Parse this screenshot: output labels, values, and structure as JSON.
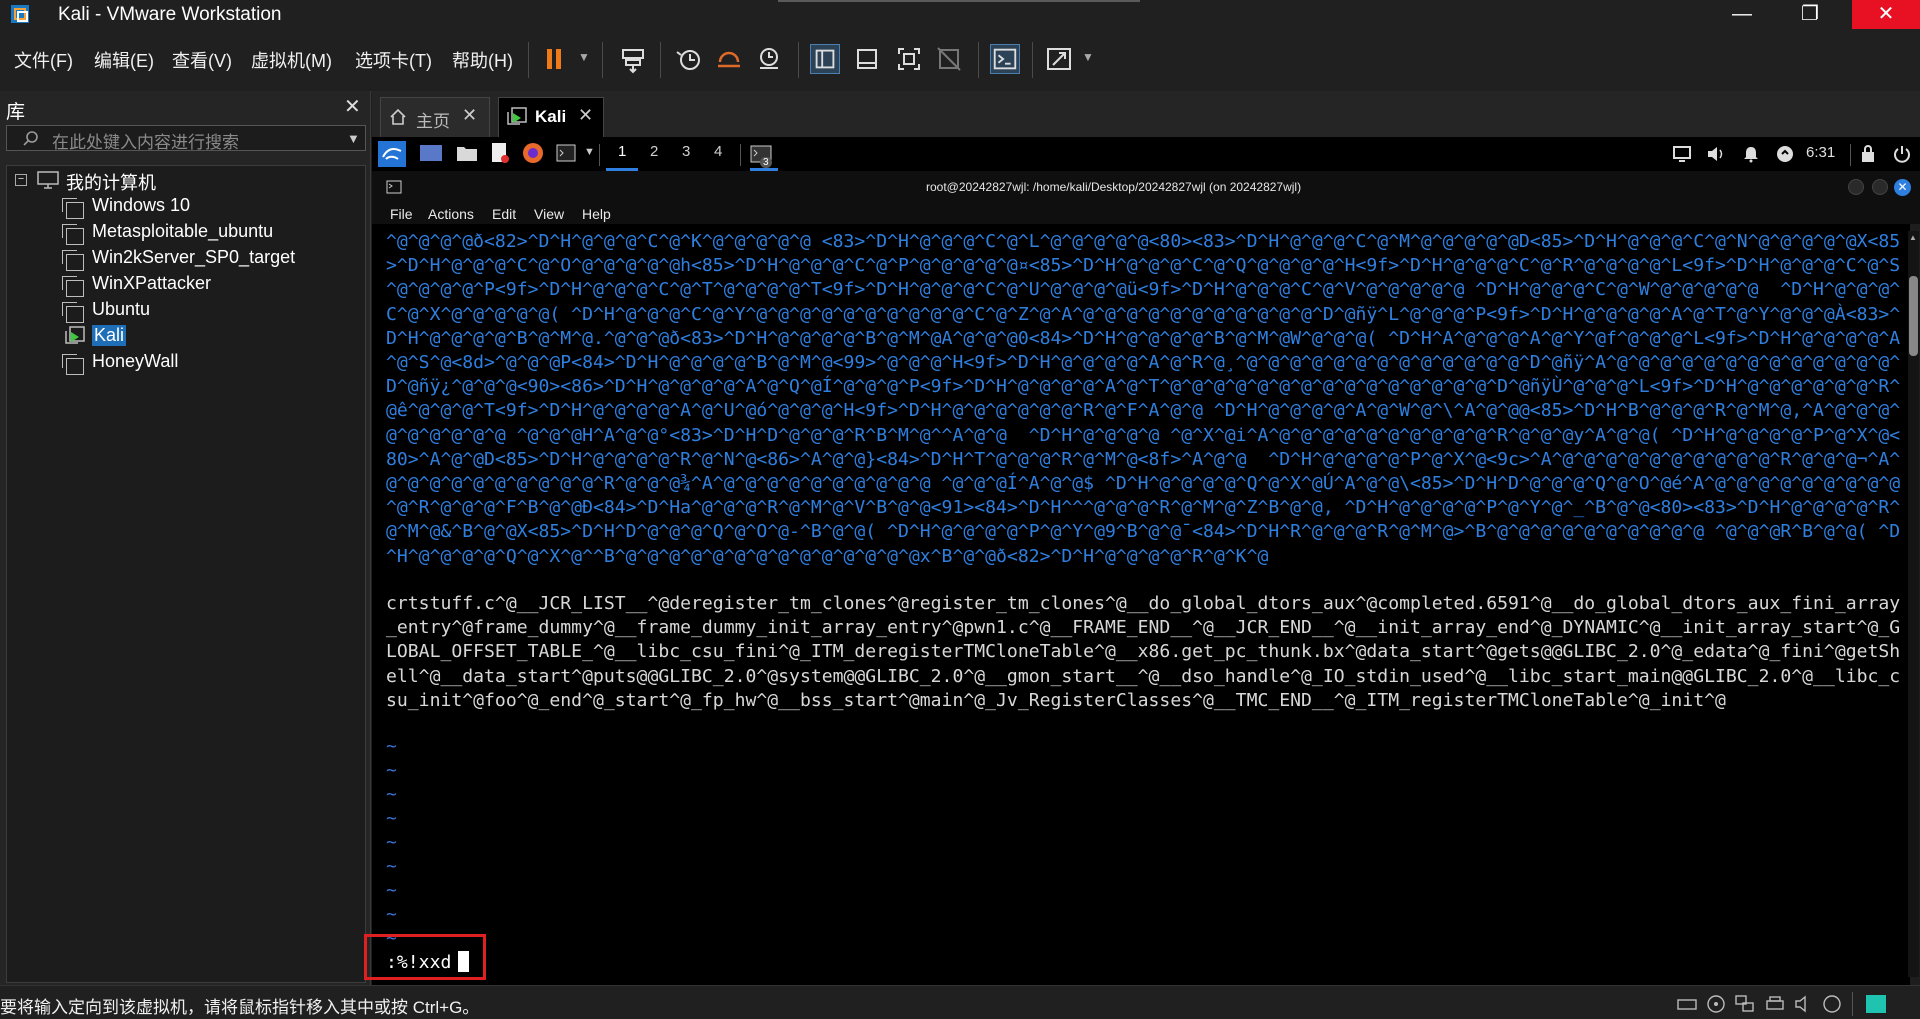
{
  "window": {
    "title": "Kali - VMware Workstation",
    "minimize": "—",
    "maximize": "❐",
    "close": "✕"
  },
  "menu": [
    "文件(F)",
    "编辑(E)",
    "查看(V)",
    "虚拟机(M)",
    "选项卡(T)",
    "帮助(H)"
  ],
  "library": {
    "title": "库",
    "close": "✕",
    "search_placeholder": "在此处键入内容进行搜索",
    "root": "我的计算机",
    "vms": [
      "Windows 10",
      "Metasploitable_ubuntu",
      "Win2kServer_SP0_target",
      "WinXPattacker",
      "Ubuntu",
      "Kali",
      "HoneyWall"
    ],
    "selected": "Kali"
  },
  "tabs": [
    {
      "label": "主页",
      "active": false
    },
    {
      "label": "Kali",
      "active": true
    }
  ],
  "kali_panel": {
    "workspaces": [
      "1",
      "2",
      "3",
      "4"
    ],
    "active_workspace": "1",
    "clock": "6:31",
    "badge": "3"
  },
  "terminal": {
    "title": "root@20242827wjl: /home/kali/Desktop/20242827wjl (on 20242827wjl)",
    "menu": [
      "File",
      "Actions",
      "Edit",
      "View",
      "Help"
    ],
    "hex_lines": "^@^@^@^@ð<82>^D^H^@^@^@^C^@^K^@^@^@^@^@ <83>^D^H^@^@^@^C^@^L^@^@^@^@^@<80><83>^D^H^@^@^@^C^@^M^@^@^@^@^@D<85>^D^H^@^@^@^C^@^N^@^@^@^@^@X<85>^D^H^@^@^@^C^@^O^@^@^@^@^@h<85>^D^H^@^@^@^C^@^P^@^@^@^@^@¤<85>^D^H^@^@^@^C^@^Q^@^@^@^@^H<9f>^D^H^@^@^@^C^@^R^@^@^@^@^L<9f>^D^H^@^@^@^C^@^S^@^@^@^@^P<9f>^D^H^@^@^@^C^@^T^@^@^@^@^T<9f>^D^H^@^@^@^C^@^U^@^@^@^@ü<9f>^D^H^@^@^@^C^@^V^@^@^@^@^@ ^D^H^@^@^@^C^@^W^@^@^@^@^@  ^D^H^@^@^@^C^@^X^@^@^@^@^@( ^D^H^@^@^@^C^@^Y^@^@^@^@^@^@^@^@^@^@^C^@^Z^@^A^@^@^@^@^@^@^@^@^@^@^@^D^@ñÿ^L^@^@^@^P<9f>^D^H^@^@^@^@^A^@^T^@^Y^@^@^@À<83>^D^H^@^@^@^@^B^@^M^@.^@^@^@ð<83>^D^H^@^@^@^@^B^@^M^@A^@^@^@0<84>^D^H^@^@^@^@^B^@^M^@W^@^@^@( ^D^H^A^@^@^@^A^@^Y^@f^@^@^@^L<9f>^D^H^@^@^@^@^A^@^S^@<8d>^@^@^@P<84>^D^H^@^@^@^@^B^@^M^@<99>^@^@^@^H<9f>^D^H^@^@^@^@^A^@^R^@¸^@^@^@^@^@^@^@^@^@^@^@^@^@^D^@ñÿ^A^@^@^@^@^@^@^@^@^@^@^@^@^@^D^@ñÿ¿^@^@^@<90><86>^D^H^@^@^@^@^A^@^Q^@Í^@^@^@^P<9f>^D^H^@^@^@^@^A^@^T^@^@^@^@^@^@^@^@^@^@^@^@^@^@^@^D^@ñÿÙ^@^@^@^L<9f>^D^H^@^@^@^@^@^@^R^@ê^@^@^@^T<9f>^D^H^@^@^@^@^A^@^U^@ó^@^@^@^H<9f>^D^H^@^@^@^@^@^@^R^@^F^A^@^@ ^D^H^@^@^@^@^A^@^W^@^\\^A^@^@@<85>^D^H^B^@^@^@^R^@^M^@,^A^@^@^@^@^@^@^@^@^@ ^@^@^@H^A^@^@°<83>^D^H^D^@^@^@^R^B^M^@^^A^@^@  ^D^H^@^@^@^@ ^@^X^@i^A^@^@^@^@^@^@^@^@^@^@^R^@^@^@y^A^@^@( ^D^H^@^@^@^@^P^@^X^@<80>^A^@^@D<85>^D^H^@^@^@^@^R^@^N^@<86>^A^@^@}<84>^D^H^T^@^@^@^R^@^M^@<8f>^A^@^@  ^D^H^@^@^@^@^P^@^X^@<9c>^A^@^@^@^@^@^@^@^@^@^@^R^@^@^@¬^A^@^@^@^@^@^@^@^@^@^@^R^@^@^@¾^A^@^@^@^@^@^@^@^@^@^@ ^@^@^@Í^A^@^@$ ^D^H^@^@^@^@^Q^@^X^@Ú^A^@^@\\<85>^D^H^D^@^@^@^Q^@^O^@é^A^@^@^@^@^@^@^@^@^@^@^R^@^@^@^F^B^@^@Ð<84>^D^Ha^@^@^@^R^@^M^@^V^B^@^@<91><84>^D^H^^^@^@^@^R^@^M^@^Z^B^@^@, ^D^H^@^@^@^@^P^@^Y^@^_^B^@^@<80><83>^D^H^@^@^@^@^R^@^M^@&^B^@^@X<85>^D^H^D^@^@^@^Q^@^O^@-^B^@^@( ^D^H^@^@^@^@^P^@^Y^@9^B^@^@¯<84>^D^H^R^@^@^@^R^@^M^@>^B^@^@^@^@^@^@^@^@^@^@ ^@^@^@R^B^@^@( ^D^H^@^@^@^@^Q^@^X^@^^B^@^@^@^@^@^@^@^@^@^@^@^@^@^@x^B^@^@ð<82>^D^H^@^@^@^@^R^@^K^@",
    "plain_text": "crtstuff.c^@__JCR_LIST__^@deregister_tm_clones^@register_tm_clones^@__do_global_dtors_aux^@completed.6591^@__do_global_dtors_aux_fini_array_entry^@frame_dummy^@__frame_dummy_init_array_entry^@pwn1.c^@__FRAME_END__^@__JCR_END__^@__init_array_end^@_DYNAMIC^@__init_array_start^@_GLOBAL_OFFSET_TABLE_^@__libc_csu_fini^@_ITM_deregisterTMCloneTable^@__x86.get_pc_thunk.bx^@data_start^@gets@@GLIBC_2.0^@_edata^@_fini^@getShell^@__data_start^@puts@@GLIBC_2.0^@system@@GLIBC_2.0^@__gmon_start__^@__dso_handle^@_IO_stdin_used^@__libc_start_main@@GLIBC_2.0^@__libc_csu_init^@foo^@_end^@_start^@_fp_hw^@__bss_start^@main^@_Jv_RegisterClasses^@__TMC_END__^@_ITM_registerTMCloneTable^@_init^@",
    "tilde": "~",
    "command": ":%!xxd"
  },
  "status_bar": "要将输入定向到该虚拟机，请将鼠标指针移入其中或按 Ctrl+G。",
  "colors": {
    "hex_text": "#2f7fe0",
    "highlight_box": "#e02020",
    "close_red": "#e81123"
  }
}
